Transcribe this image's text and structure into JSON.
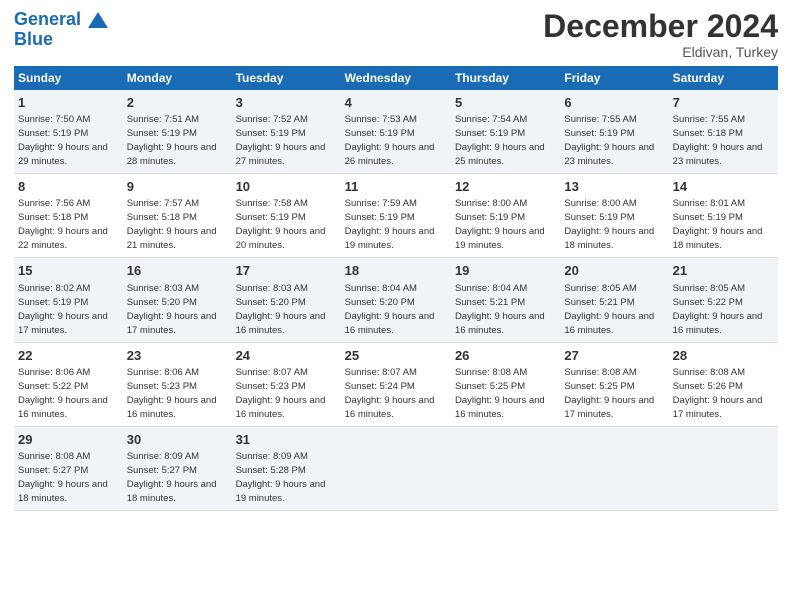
{
  "header": {
    "logo_line1": "General",
    "logo_line2": "Blue",
    "month": "December 2024",
    "location": "Eldivan, Turkey"
  },
  "weekdays": [
    "Sunday",
    "Monday",
    "Tuesday",
    "Wednesday",
    "Thursday",
    "Friday",
    "Saturday"
  ],
  "weeks": [
    [
      {
        "day": "1",
        "sunrise": "Sunrise: 7:50 AM",
        "sunset": "Sunset: 5:19 PM",
        "daylight": "Daylight: 9 hours and 29 minutes."
      },
      {
        "day": "2",
        "sunrise": "Sunrise: 7:51 AM",
        "sunset": "Sunset: 5:19 PM",
        "daylight": "Daylight: 9 hours and 28 minutes."
      },
      {
        "day": "3",
        "sunrise": "Sunrise: 7:52 AM",
        "sunset": "Sunset: 5:19 PM",
        "daylight": "Daylight: 9 hours and 27 minutes."
      },
      {
        "day": "4",
        "sunrise": "Sunrise: 7:53 AM",
        "sunset": "Sunset: 5:19 PM",
        "daylight": "Daylight: 9 hours and 26 minutes."
      },
      {
        "day": "5",
        "sunrise": "Sunrise: 7:54 AM",
        "sunset": "Sunset: 5:19 PM",
        "daylight": "Daylight: 9 hours and 25 minutes."
      },
      {
        "day": "6",
        "sunrise": "Sunrise: 7:55 AM",
        "sunset": "Sunset: 5:19 PM",
        "daylight": "Daylight: 9 hours and 23 minutes."
      },
      {
        "day": "7",
        "sunrise": "Sunrise: 7:55 AM",
        "sunset": "Sunset: 5:18 PM",
        "daylight": "Daylight: 9 hours and 23 minutes."
      }
    ],
    [
      {
        "day": "8",
        "sunrise": "Sunrise: 7:56 AM",
        "sunset": "Sunset: 5:18 PM",
        "daylight": "Daylight: 9 hours and 22 minutes."
      },
      {
        "day": "9",
        "sunrise": "Sunrise: 7:57 AM",
        "sunset": "Sunset: 5:18 PM",
        "daylight": "Daylight: 9 hours and 21 minutes."
      },
      {
        "day": "10",
        "sunrise": "Sunrise: 7:58 AM",
        "sunset": "Sunset: 5:19 PM",
        "daylight": "Daylight: 9 hours and 20 minutes."
      },
      {
        "day": "11",
        "sunrise": "Sunrise: 7:59 AM",
        "sunset": "Sunset: 5:19 PM",
        "daylight": "Daylight: 9 hours and 19 minutes."
      },
      {
        "day": "12",
        "sunrise": "Sunrise: 8:00 AM",
        "sunset": "Sunset: 5:19 PM",
        "daylight": "Daylight: 9 hours and 19 minutes."
      },
      {
        "day": "13",
        "sunrise": "Sunrise: 8:00 AM",
        "sunset": "Sunset: 5:19 PM",
        "daylight": "Daylight: 9 hours and 18 minutes."
      },
      {
        "day": "14",
        "sunrise": "Sunrise: 8:01 AM",
        "sunset": "Sunset: 5:19 PM",
        "daylight": "Daylight: 9 hours and 18 minutes."
      }
    ],
    [
      {
        "day": "15",
        "sunrise": "Sunrise: 8:02 AM",
        "sunset": "Sunset: 5:19 PM",
        "daylight": "Daylight: 9 hours and 17 minutes."
      },
      {
        "day": "16",
        "sunrise": "Sunrise: 8:03 AM",
        "sunset": "Sunset: 5:20 PM",
        "daylight": "Daylight: 9 hours and 17 minutes."
      },
      {
        "day": "17",
        "sunrise": "Sunrise: 8:03 AM",
        "sunset": "Sunset: 5:20 PM",
        "daylight": "Daylight: 9 hours and 16 minutes."
      },
      {
        "day": "18",
        "sunrise": "Sunrise: 8:04 AM",
        "sunset": "Sunset: 5:20 PM",
        "daylight": "Daylight: 9 hours and 16 minutes."
      },
      {
        "day": "19",
        "sunrise": "Sunrise: 8:04 AM",
        "sunset": "Sunset: 5:21 PM",
        "daylight": "Daylight: 9 hours and 16 minutes."
      },
      {
        "day": "20",
        "sunrise": "Sunrise: 8:05 AM",
        "sunset": "Sunset: 5:21 PM",
        "daylight": "Daylight: 9 hours and 16 minutes."
      },
      {
        "day": "21",
        "sunrise": "Sunrise: 8:05 AM",
        "sunset": "Sunset: 5:22 PM",
        "daylight": "Daylight: 9 hours and 16 minutes."
      }
    ],
    [
      {
        "day": "22",
        "sunrise": "Sunrise: 8:06 AM",
        "sunset": "Sunset: 5:22 PM",
        "daylight": "Daylight: 9 hours and 16 minutes."
      },
      {
        "day": "23",
        "sunrise": "Sunrise: 8:06 AM",
        "sunset": "Sunset: 5:23 PM",
        "daylight": "Daylight: 9 hours and 16 minutes."
      },
      {
        "day": "24",
        "sunrise": "Sunrise: 8:07 AM",
        "sunset": "Sunset: 5:23 PM",
        "daylight": "Daylight: 9 hours and 16 minutes."
      },
      {
        "day": "25",
        "sunrise": "Sunrise: 8:07 AM",
        "sunset": "Sunset: 5:24 PM",
        "daylight": "Daylight: 9 hours and 16 minutes."
      },
      {
        "day": "26",
        "sunrise": "Sunrise: 8:08 AM",
        "sunset": "Sunset: 5:25 PM",
        "daylight": "Daylight: 9 hours and 16 minutes."
      },
      {
        "day": "27",
        "sunrise": "Sunrise: 8:08 AM",
        "sunset": "Sunset: 5:25 PM",
        "daylight": "Daylight: 9 hours and 17 minutes."
      },
      {
        "day": "28",
        "sunrise": "Sunrise: 8:08 AM",
        "sunset": "Sunset: 5:26 PM",
        "daylight": "Daylight: 9 hours and 17 minutes."
      }
    ],
    [
      {
        "day": "29",
        "sunrise": "Sunrise: 8:08 AM",
        "sunset": "Sunset: 5:27 PM",
        "daylight": "Daylight: 9 hours and 18 minutes."
      },
      {
        "day": "30",
        "sunrise": "Sunrise: 8:09 AM",
        "sunset": "Sunset: 5:27 PM",
        "daylight": "Daylight: 9 hours and 18 minutes."
      },
      {
        "day": "31",
        "sunrise": "Sunrise: 8:09 AM",
        "sunset": "Sunset: 5:28 PM",
        "daylight": "Daylight: 9 hours and 19 minutes."
      },
      null,
      null,
      null,
      null
    ]
  ]
}
